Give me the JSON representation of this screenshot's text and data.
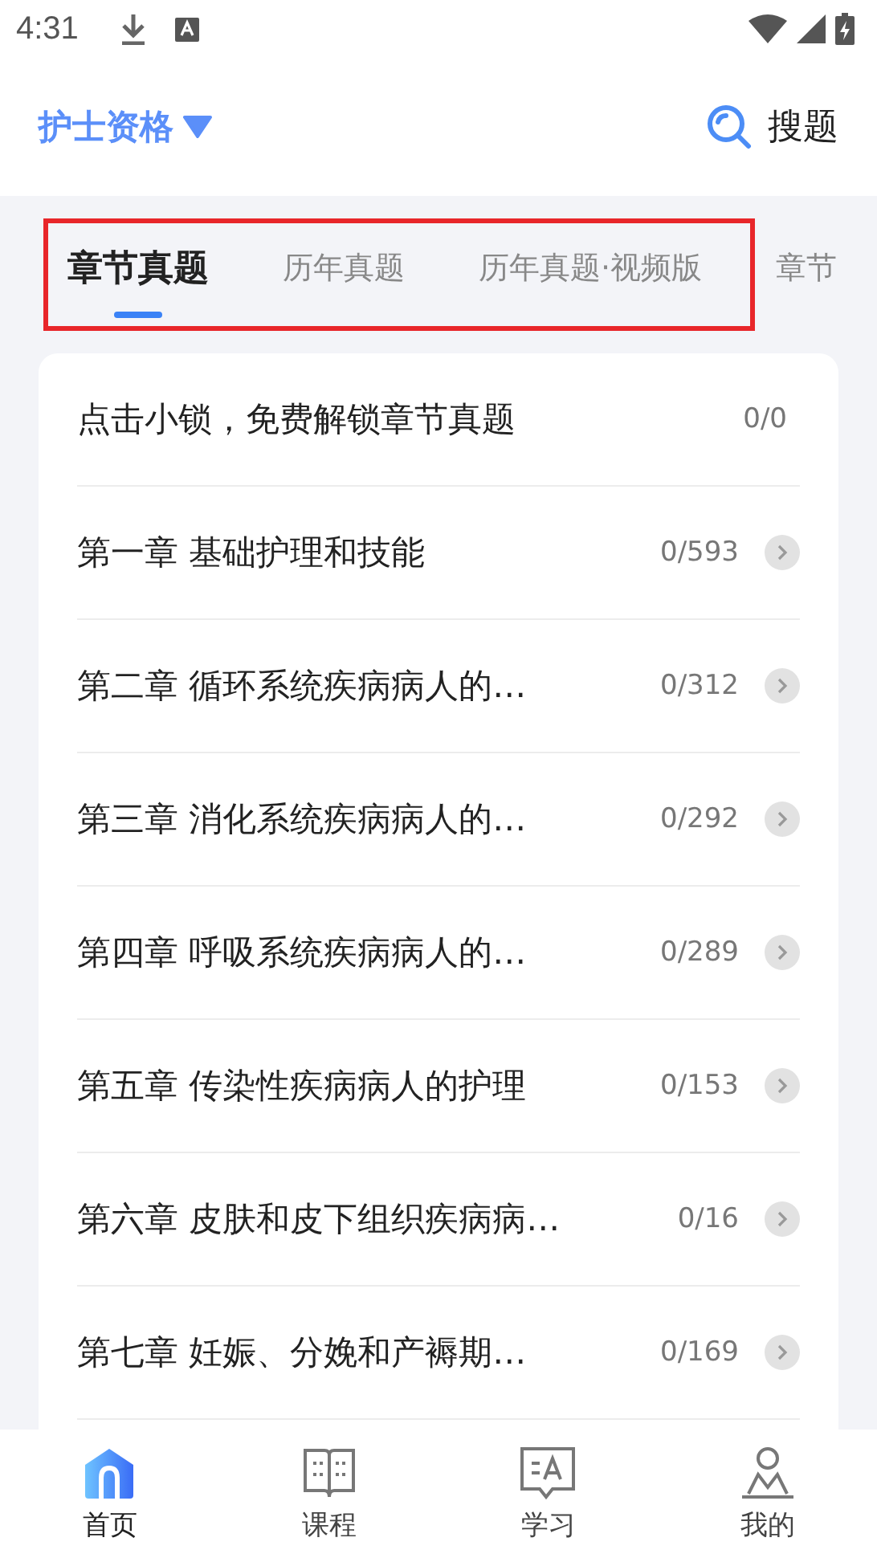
{
  "status_bar": {
    "time": "4:31"
  },
  "header": {
    "exam": "护士资格",
    "search": "搜题"
  },
  "tabs": [
    {
      "label": "章节真题",
      "selected": true
    },
    {
      "label": "历年真题",
      "selected": false
    },
    {
      "label": "历年真题·视频版",
      "selected": false
    },
    {
      "label": "章节",
      "selected": false
    }
  ],
  "chapters": [
    {
      "kind": "unlock",
      "title": "点击小锁，免费解锁章节真题",
      "progress": "0/0"
    },
    {
      "kind": "chapter",
      "title": "第一章 基础护理和技能",
      "progress": "0/593"
    },
    {
      "kind": "chapter",
      "title": "第二章 循环系统疾病病人的…",
      "progress": "0/312"
    },
    {
      "kind": "chapter",
      "title": "第三章 消化系统疾病病人的…",
      "progress": "0/292"
    },
    {
      "kind": "chapter",
      "title": "第四章 呼吸系统疾病病人的…",
      "progress": "0/289"
    },
    {
      "kind": "chapter",
      "title": "第五章 传染性疾病病人的护理",
      "progress": "0/153"
    },
    {
      "kind": "chapter",
      "title": "第六章 皮肤和皮下组织疾病病…",
      "progress": "0/16"
    },
    {
      "kind": "chapter",
      "title": "第七章 妊娠、分娩和产褥期…",
      "progress": "0/169"
    }
  ],
  "bottom_nav": [
    {
      "kind": "home",
      "label": "首页",
      "selected": true
    },
    {
      "kind": "course",
      "label": "课程",
      "selected": false
    },
    {
      "kind": "study",
      "label": "学习",
      "selected": false
    },
    {
      "kind": "profile",
      "label": "我的",
      "selected": false
    }
  ]
}
